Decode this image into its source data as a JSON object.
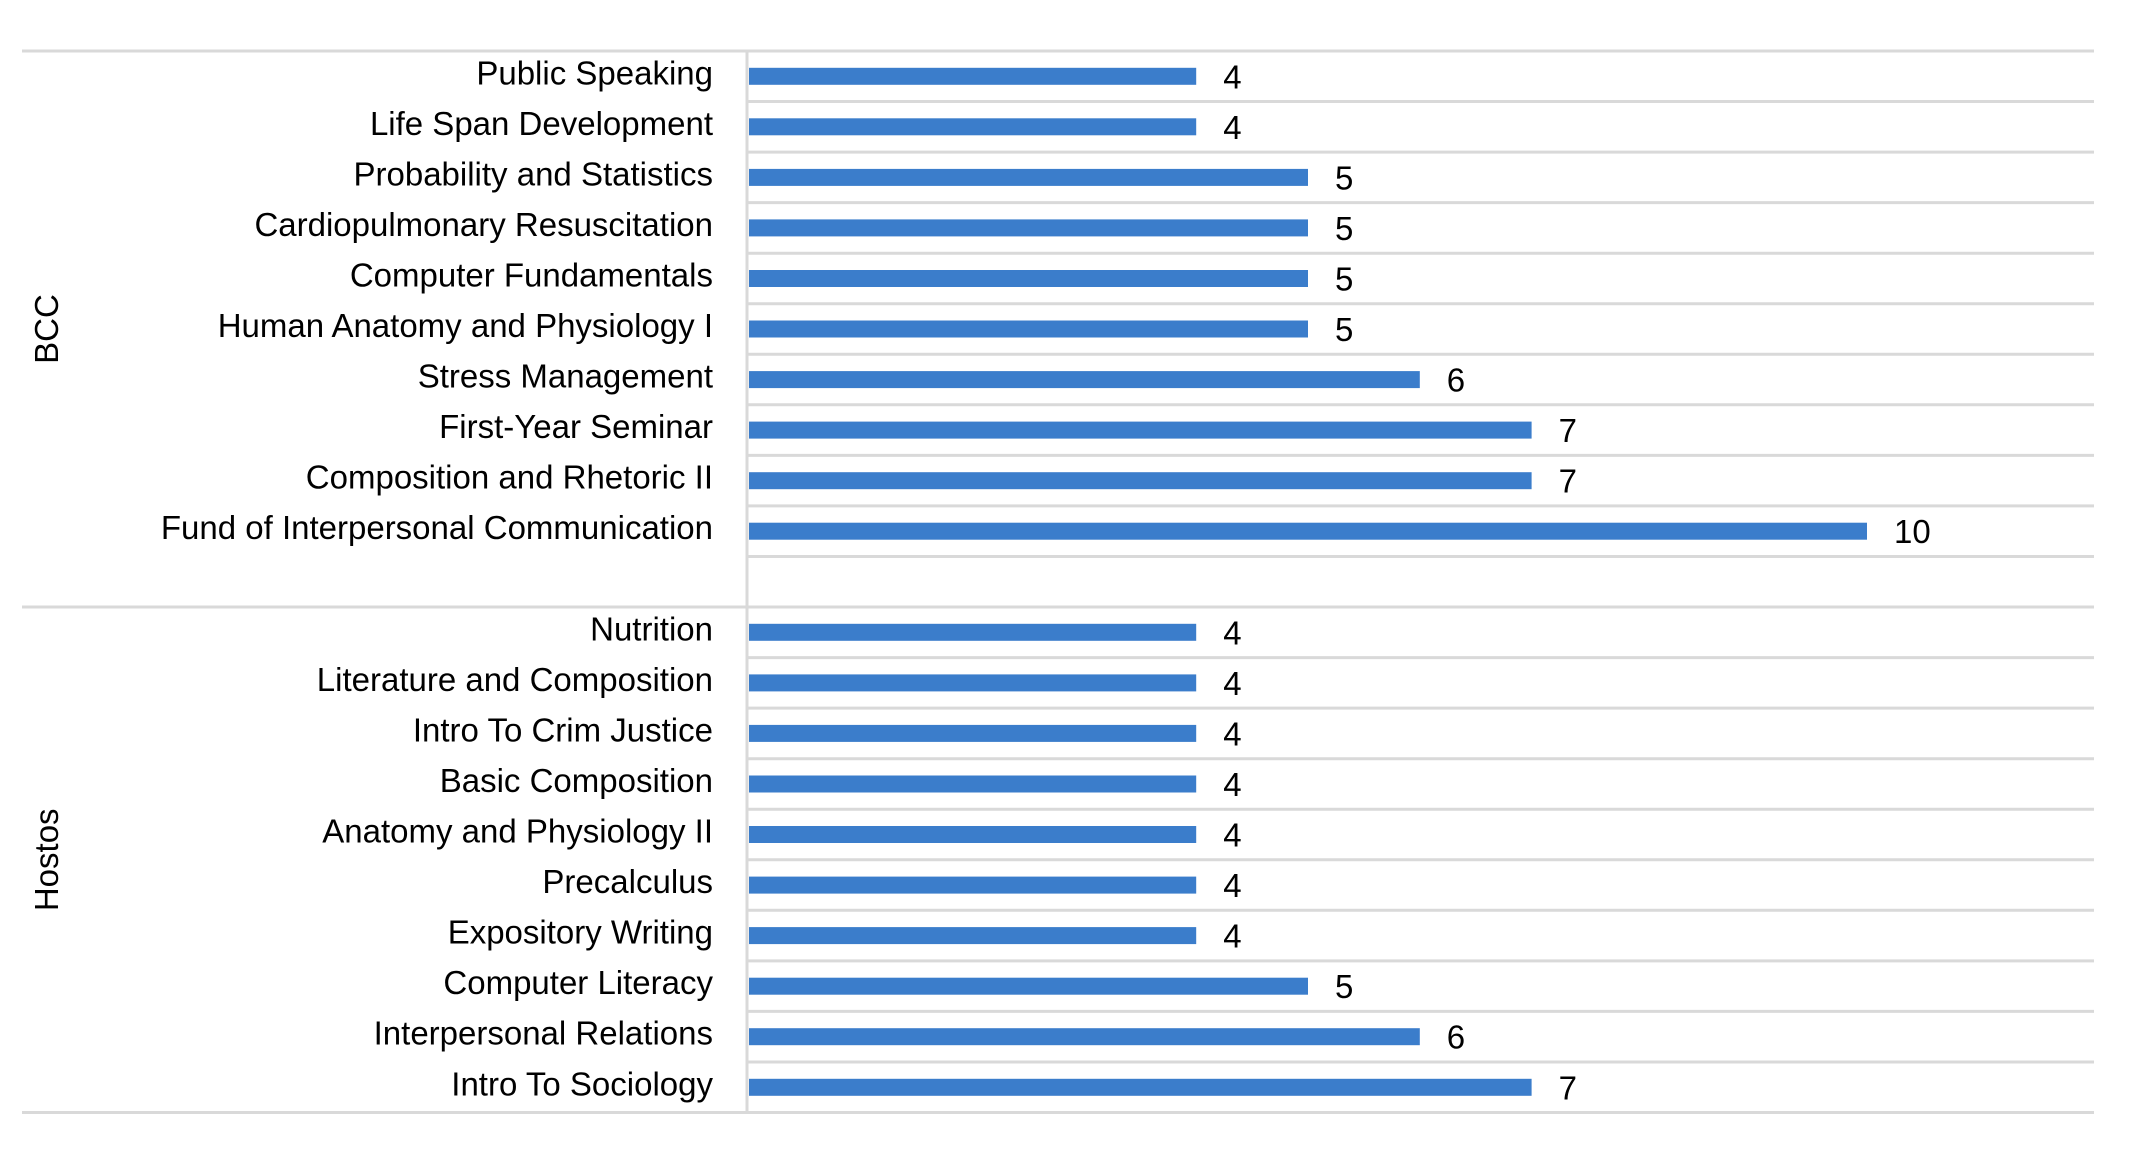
{
  "chart_data": {
    "type": "bar",
    "orientation": "horizontal",
    "title": "",
    "xlabel": "",
    "ylabel": "",
    "xlim": [
      0,
      13
    ],
    "grid": true,
    "legend": "none",
    "bar_color": "#3b7dcb",
    "gridline_color": "#d9d9d9",
    "groups": [
      {
        "name": "BCC",
        "categories": [
          "Public Speaking",
          "Life Span Development",
          "Probability and Statistics",
          "Cardiopulmonary Resuscitation",
          "Computer Fundamentals",
          "Human Anatomy and Physiology I",
          "Stress Management",
          "First-Year Seminar",
          "Composition and Rhetoric II",
          "Fund of Interpersonal Communication"
        ],
        "values": [
          4,
          4,
          5,
          5,
          5,
          5,
          6,
          7,
          7,
          10
        ],
        "data_labels": [
          "4",
          "4",
          "5",
          "5",
          "5",
          "5",
          "6",
          "7",
          "7",
          "10"
        ]
      },
      {
        "name": "Hostos",
        "categories": [
          "Nutrition",
          "Literature and Composition",
          "Intro To Crim Justice",
          "Basic Composition",
          "Anatomy and Physiology II",
          "Precalculus",
          "Expository Writing",
          "Computer Literacy",
          "Interpersonal Relations",
          "Intro To Sociology"
        ],
        "values": [
          4,
          4,
          4,
          4,
          4,
          4,
          4,
          5,
          6,
          7
        ],
        "data_labels": [
          "4",
          "4",
          "4",
          "4",
          "4",
          "4",
          "4",
          "5",
          "6",
          "7"
        ]
      }
    ]
  }
}
